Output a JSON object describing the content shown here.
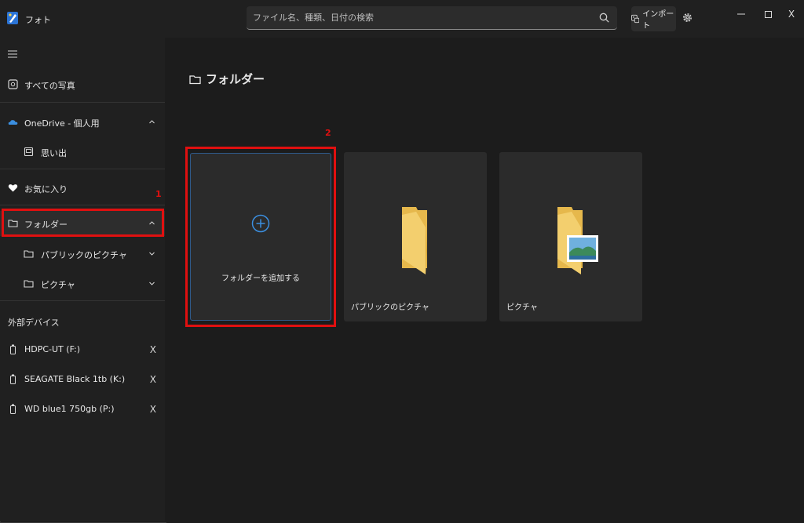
{
  "app": {
    "title": "フォト"
  },
  "search": {
    "placeholder": "ファイル名、種類、日付の検索"
  },
  "toolbar": {
    "import_label": "インポート"
  },
  "window": {
    "close_glyph": "X"
  },
  "sidebar": {
    "all_photos": "すべての写真",
    "onedrive": "OneDrive - 個人用",
    "memories": "思い出",
    "favorites": "お気に入り",
    "folders": "フォルダー",
    "public_pictures": "パブリックのピクチャ",
    "pictures": "ピクチャ",
    "external_devices_header": "外部デバイス",
    "devices": [
      {
        "label": "HDPC-UT (F:)",
        "eject": "X"
      },
      {
        "label": "SEAGATE Black 1tb (K:)",
        "eject": "X"
      },
      {
        "label": "WD blue1 750gb (P:)",
        "eject": "X"
      }
    ]
  },
  "main": {
    "title": "フォルダー",
    "add_folder_label": "フォルダーを追加する",
    "folders": [
      {
        "label": "パブリックのピクチャ"
      },
      {
        "label": "ピクチャ"
      }
    ]
  },
  "annotations": {
    "step1": "1",
    "step2": "2"
  },
  "colors": {
    "highlight": "#e01010",
    "accent": "#3b8fe0",
    "folder": "#f3cf6e"
  }
}
